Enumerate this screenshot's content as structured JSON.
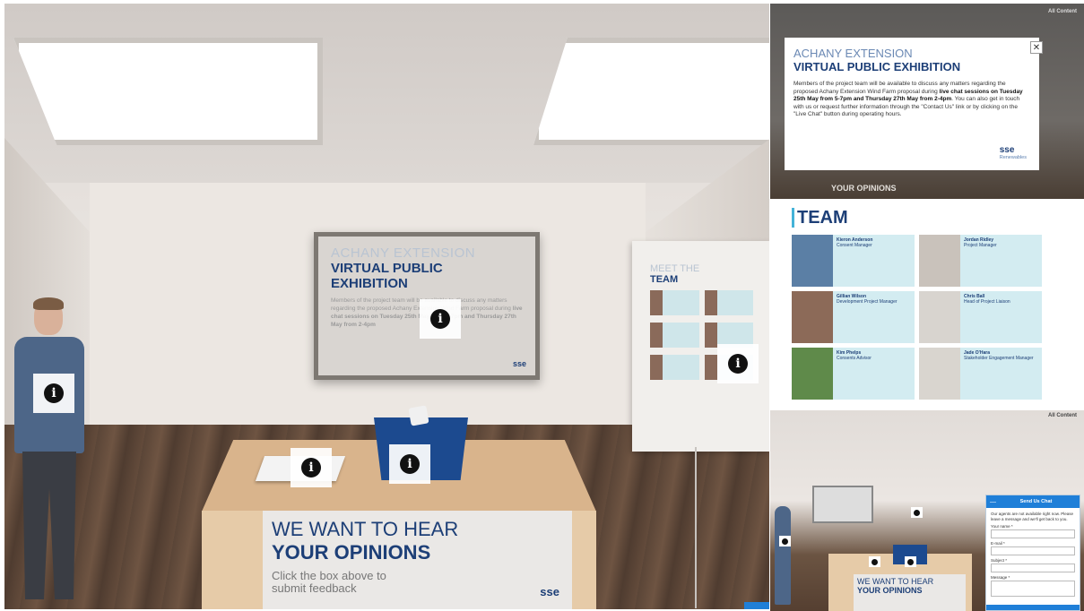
{
  "main": {
    "wall_screen": {
      "title_line1": "ACHANY EXTENSION",
      "title_line2": "VIRTUAL PUBLIC EXHIBITION",
      "logo": "sse"
    },
    "team_board": {
      "title_line1": "MEET THE",
      "title_line2": "TEAM"
    },
    "desk_sign": {
      "line1": "WE WANT TO HEAR",
      "line2": "YOUR OPINIONS",
      "sub": "Click the box above to submit feedback",
      "logo": "sse"
    },
    "info_icon_glyph": "i"
  },
  "popup_panel": {
    "corner_label": "All Content",
    "title_line1": "ACHANY EXTENSION",
    "title_line2": "VIRTUAL PUBLIC EXHIBITION",
    "body_part1": "Members of the project team will be available to discuss any matters regarding the proposed Achany Extension Wind Farm proposal during ",
    "body_bold": "live chat sessions on Tuesday 25th May from 5-7pm and Thursday 27th May from 2-4pm",
    "body_part2": ". You can also get in touch with us or request further information through the \"Contact Us\" link or by clicking on the \"Live Chat\" button during operating hours.",
    "logo_main": "sse",
    "logo_sub": "Renewables",
    "close_glyph": "✕",
    "background_text": "YOUR OPINIONS"
  },
  "team_panel": {
    "heading": "TEAM",
    "members": [
      {
        "name": "Kieron Anderson",
        "role": "Consent Manager",
        "photo_color": "#5b7fa5"
      },
      {
        "name": "Jordan Ridley",
        "role": "Project Manager",
        "photo_color": "#c9c2bb"
      },
      {
        "name": "Gillian Wilson",
        "role": "Development Project Manager",
        "photo_color": "#8c6a58"
      },
      {
        "name": "Chris Ball",
        "role": "Head of Project Liaison",
        "photo_color": "#d8d4cf"
      },
      {
        "name": "Kim Phelps",
        "role": "Consents Advisor",
        "photo_color": "#5f8a4a"
      },
      {
        "name": "Jade O'Hara",
        "role": "Stakeholder Engagement Manager",
        "photo_color": "#d9d5cf"
      }
    ]
  },
  "chat_panel": {
    "corner_label": "All Content",
    "sign_line1": "WE WANT TO HEAR",
    "sign_line2": "YOUR OPINIONS",
    "widget": {
      "title": "Send Us Chat",
      "minimize_glyph": "—",
      "intro": "Our agents are not available right now. Please leave a message and we'll get back to you.",
      "fields": [
        "Your name *",
        "E-mail *",
        "Subject *",
        "Message *"
      ]
    }
  }
}
